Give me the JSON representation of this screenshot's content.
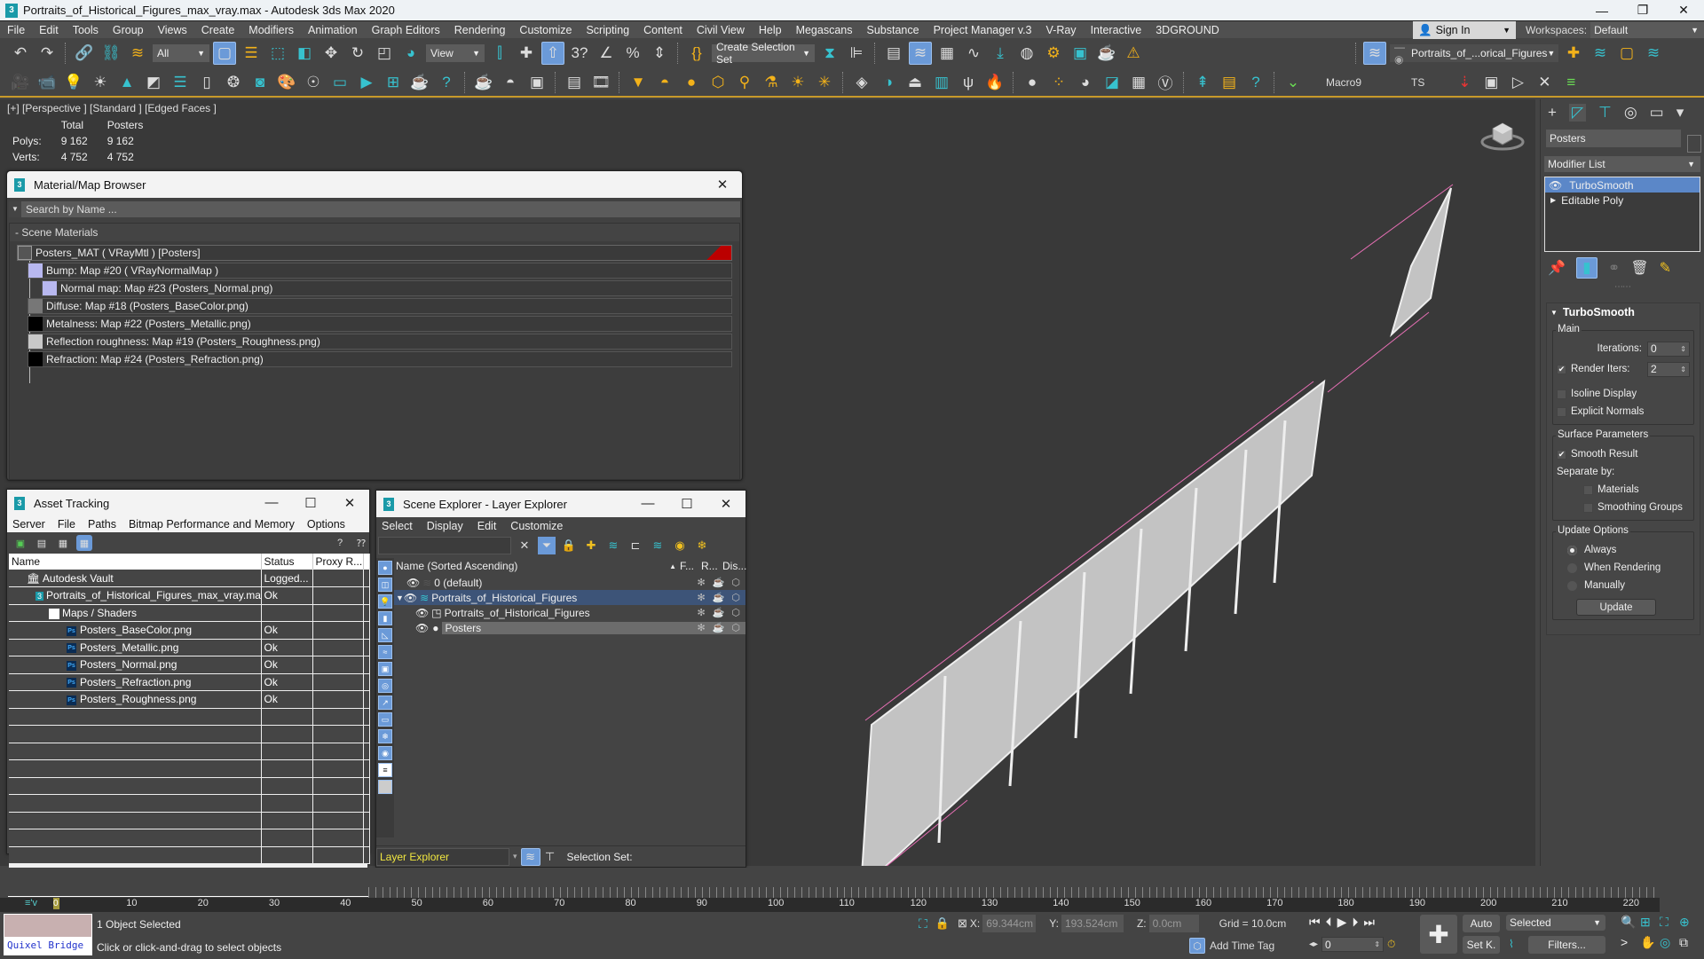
{
  "window": {
    "title": "Portraits_of_Historical_Figures_max_vray.max - Autodesk 3ds Max 2020",
    "app_icon": "3ds-max-icon",
    "controls": {
      "minimize": "—",
      "maximize": "❐",
      "close": "✕"
    }
  },
  "menubar": {
    "items": [
      "File",
      "Edit",
      "Tools",
      "Group",
      "Views",
      "Create",
      "Modifiers",
      "Animation",
      "Graph Editors",
      "Rendering",
      "Customize",
      "Scripting",
      "Content",
      "Civil View",
      "Help",
      "Megascans",
      "Substance",
      "Project Manager v.3",
      "V-Ray",
      "Interactive",
      "3DGROUND"
    ],
    "sign_in": "Sign In",
    "workspaces_label": "Workspaces:",
    "workspace_value": "Default"
  },
  "toolbar": {
    "selection_filter": "All",
    "ref_coord": "View",
    "selection_set": "Create Selection Set",
    "layer_dropdown": "Portraits_of_...orical_Figures",
    "macro_label": "Macro9",
    "ts_label": "TS"
  },
  "viewport": {
    "label": "[+] [Perspective ] [Standard ] [Edged Faces ]",
    "stats": {
      "col_total": "Total",
      "col_object": "Posters",
      "polys_label": "Polys:",
      "polys_total": "9 162",
      "polys_object": "9 162",
      "verts_label": "Verts:",
      "verts_total": "4 752",
      "verts_object": "4 752"
    }
  },
  "material_browser": {
    "title": "Material/Map Browser",
    "search_placeholder": "Search by Name ...",
    "group": "- Scene Materials",
    "material": "Posters_MAT  ( VRayMtl )  [Posters]",
    "maps": [
      {
        "label": "Bump: Map #20  ( VRayNormalMap )",
        "swatch": "#b8b8f0",
        "level": 1
      },
      {
        "label": "Normal map: Map #23 (Posters_Normal.png)",
        "swatch": "#b8b8f0",
        "level": 2
      },
      {
        "label": "Diffuse: Map #18 (Posters_BaseColor.png)",
        "swatch": "#777777",
        "level": 1
      },
      {
        "label": "Metalness: Map #22 (Posters_Metallic.png)",
        "swatch": "#000000",
        "level": 1
      },
      {
        "label": "Reflection roughness: Map #19 (Posters_Roughness.png)",
        "swatch": "#c8c8c8",
        "level": 1
      },
      {
        "label": "Refraction: Map #24 (Posters_Refraction.png)",
        "swatch": "#000000",
        "level": 1
      }
    ]
  },
  "asset_tracking": {
    "title": "Asset Tracking",
    "menu": [
      "Server",
      "File",
      "Paths",
      "Bitmap Performance and Memory",
      "Options"
    ],
    "columns": [
      "Name",
      "Status",
      "Proxy R...",
      ""
    ],
    "rows": [
      {
        "name": "Autodesk Vault",
        "status": "Logged...",
        "indent": 1,
        "icon": "vault"
      },
      {
        "name": "Portraits_of_Historical_Figures_max_vray.max",
        "status": "Ok",
        "indent": 2,
        "icon": "max"
      },
      {
        "name": "Maps / Shaders",
        "status": "",
        "indent": 3,
        "icon": "folder"
      },
      {
        "name": "Posters_BaseColor.png",
        "status": "Ok",
        "indent": 4,
        "icon": "ps"
      },
      {
        "name": "Posters_Metallic.png",
        "status": "Ok",
        "indent": 4,
        "icon": "ps"
      },
      {
        "name": "Posters_Normal.png",
        "status": "Ok",
        "indent": 4,
        "icon": "ps"
      },
      {
        "name": "Posters_Refraction.png",
        "status": "Ok",
        "indent": 4,
        "icon": "ps"
      },
      {
        "name": "Posters_Roughness.png",
        "status": "Ok",
        "indent": 4,
        "icon": "ps"
      }
    ]
  },
  "scene_explorer": {
    "title": "Scene Explorer - Layer Explorer",
    "menu": [
      "Select",
      "Display",
      "Edit",
      "Customize"
    ],
    "columns": {
      "name": "Name (Sorted Ascending)",
      "freeze": "F...",
      "render": "R...",
      "display": "Dis..."
    },
    "rows": [
      {
        "name": "0 (default)",
        "type": "layer"
      },
      {
        "name": "Portraits_of_Historical_Figures",
        "type": "layer",
        "selected": true,
        "expanded": true
      },
      {
        "name": "Portraits_of_Historical_Figures",
        "type": "group"
      },
      {
        "name": "Posters",
        "type": "object",
        "highlighted": true
      }
    ],
    "footer": {
      "explorer": "Layer Explorer",
      "selection_set_label": "Selection Set:"
    }
  },
  "command_panel": {
    "object_name": "Posters",
    "modifier_list": "Modifier List",
    "stack": [
      "TurboSmooth",
      "Editable Poly"
    ],
    "rollout_title": "TurboSmooth",
    "main": {
      "group": "Main",
      "iterations_label": "Iterations:",
      "iterations": "0",
      "render_iters_label": "Render Iters:",
      "render_iters": "2",
      "render_iters_checked": true,
      "isoline_label": "Isoline Display",
      "isoline_checked": false,
      "explicit_label": "Explicit Normals",
      "explicit_checked": false
    },
    "surface": {
      "group": "Surface Parameters",
      "smooth_label": "Smooth Result",
      "smooth_checked": true,
      "separate_label": "Separate by:",
      "materials_label": "Materials",
      "smoothing_label": "Smoothing Groups"
    },
    "update": {
      "group": "Update Options",
      "options": [
        "Always",
        "When Rendering",
        "Manually"
      ],
      "selected": "Always",
      "button": "Update"
    }
  },
  "timeline": {
    "current_frame": "0",
    "ticks": [
      "0",
      "10",
      "20",
      "30",
      "40",
      "50",
      "60",
      "70",
      "80",
      "90",
      "100",
      "110",
      "120",
      "130",
      "140",
      "150",
      "160",
      "170",
      "180",
      "190",
      "200",
      "210",
      "220"
    ]
  },
  "status": {
    "quixel": "Quixel Bridge",
    "selected": "1 Object Selected",
    "prompt": "Click or click-and-drag to select objects",
    "x_label": "X:",
    "x": "69.344cm",
    "y_label": "Y:",
    "y": "193.524cm",
    "z_label": "Z:",
    "z": "0.0cm",
    "grid": "Grid = 10.0cm",
    "add_time_tag": "Add Time Tag",
    "frame": "0",
    "auto": "Auto",
    "set_key": "Set K.",
    "key_filter": "Selected",
    "filters": "Filters..."
  }
}
